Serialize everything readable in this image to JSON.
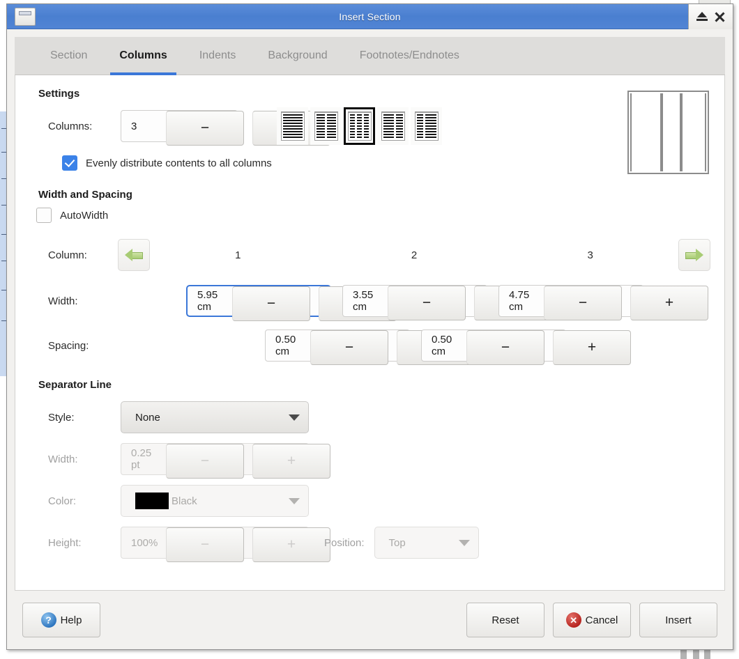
{
  "window": {
    "title": "Insert Section",
    "left_icon": "window-restore-icon",
    "eject_icon": "eject-icon",
    "close_icon": "close-icon"
  },
  "tabs": [
    {
      "label": "Section",
      "active": false
    },
    {
      "label": "Columns",
      "active": true
    },
    {
      "label": "Indents",
      "active": false
    },
    {
      "label": "Background",
      "active": false
    },
    {
      "label": "Footnotes/Endnotes",
      "active": false
    }
  ],
  "settings": {
    "group_title": "Settings",
    "columns_label": "Columns:",
    "columns_value": "3",
    "minus": "−",
    "plus": "+",
    "presets": [
      {
        "name": "one-column",
        "cols": 1,
        "selected": false
      },
      {
        "name": "two-columns",
        "cols": 2,
        "selected": false
      },
      {
        "name": "three-columns",
        "cols": 3,
        "selected": true
      },
      {
        "name": "two-columns-left-wide",
        "cols": 2,
        "selected": false
      },
      {
        "name": "two-columns-right-wide",
        "cols": 2,
        "selected": false
      }
    ],
    "evenly_distribute_label": "Evenly distribute contents to all columns",
    "evenly_distribute_checked": true,
    "preview_widths": [
      5.95,
      3.55,
      4.75
    ]
  },
  "width_spacing": {
    "group_title": "Width and Spacing",
    "autowidth_label": "AutoWidth",
    "autowidth_checked": false,
    "column_label": "Column:",
    "column_numbers": [
      "1",
      "2",
      "3"
    ],
    "prev_arrow": "arrow-left-icon",
    "next_arrow": "arrow-right-icon",
    "width_label": "Width:",
    "widths": [
      "5.95 cm",
      "3.55 cm",
      "4.75 cm"
    ],
    "width_focused_index": 0,
    "spacing_label": "Spacing:",
    "spacings": [
      "0.50 cm",
      "0.50 cm"
    ],
    "minus": "−",
    "plus": "+"
  },
  "separator_line": {
    "group_title": "Separator Line",
    "style_label": "Style:",
    "style_value": "None",
    "width_label": "Width:",
    "width_value": "0.25 pt",
    "color_label": "Color:",
    "color_value": "Black",
    "color_hex": "#000000",
    "height_label": "Height:",
    "height_value": "100%",
    "position_label": "Position:",
    "position_value": "Top",
    "minus": "−",
    "plus": "+"
  },
  "footer": {
    "help_label": "Help",
    "help_icon_glyph": "?",
    "reset_label": "Reset",
    "cancel_label": "Cancel",
    "cancel_icon_glyph": "✕",
    "insert_label": "Insert"
  },
  "colors": {
    "titlebar": "#4a7fd0",
    "accent": "#3b77d8",
    "checkbox_on": "#3b82e8",
    "panel_bg": "#ffffff",
    "dialog_bg": "#f2f1ef"
  }
}
